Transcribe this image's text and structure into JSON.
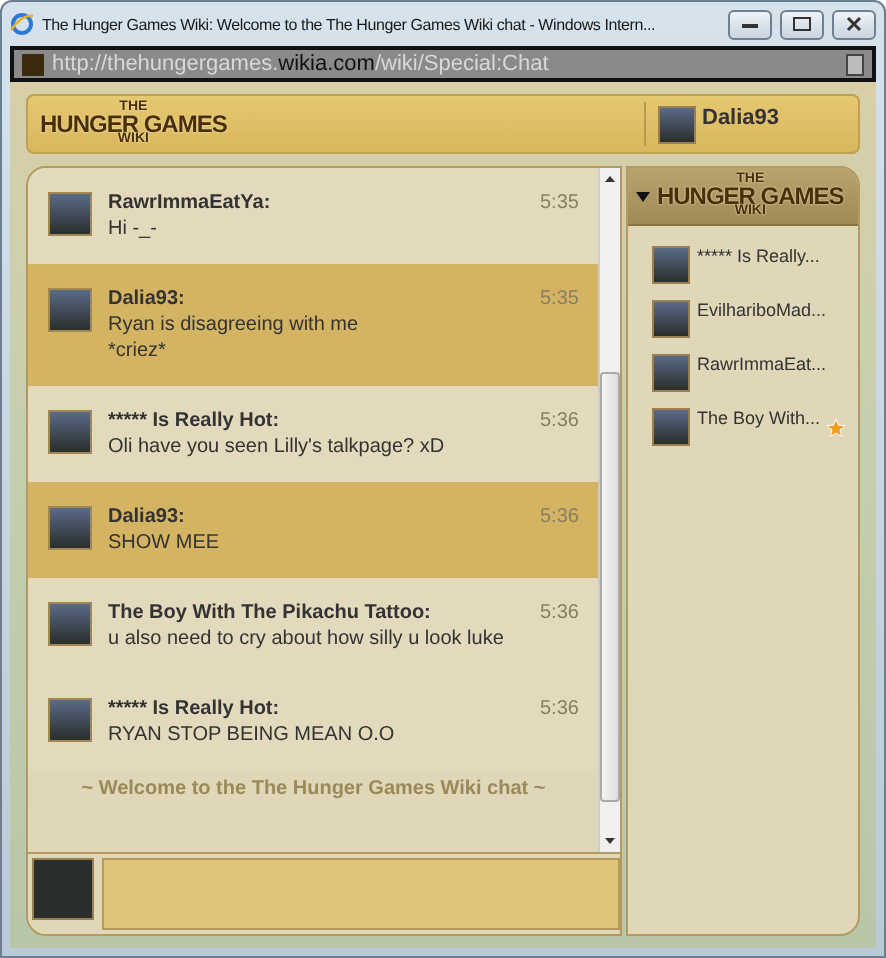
{
  "window": {
    "title": "The Hunger Games Wiki: Welcome to the The Hunger Games Wiki chat - Windows Intern..."
  },
  "address_bar": {
    "url_start": "http://thehungergames.",
    "url_domain": "wikia.com",
    "url_end": "/wiki/Special:Chat"
  },
  "header": {
    "logo": [
      "THE",
      "HUNGER GAMES",
      "WIKI"
    ],
    "user": "Dalia93"
  },
  "messages": [
    {
      "user": "RawrImmaEatYa:",
      "text": [
        "Hi -_-"
      ],
      "time": "5:35",
      "highlighted": false
    },
    {
      "user": "Dalia93:",
      "text": [
        "Ryan is disagreeing with me",
        "*criez*"
      ],
      "time": "5:35",
      "highlighted": true
    },
    {
      "user": "***** Is Really Hot:",
      "text": [
        "Oli have you seen Lilly's talkpage? xD"
      ],
      "time": "5:36",
      "highlighted": false
    },
    {
      "user": "Dalia93:",
      "text": [
        "SHOW MEE"
      ],
      "time": "5:36",
      "highlighted": true
    },
    {
      "user": "The Boy With The Pikachu Tattoo:",
      "text": [
        "u also need to cry about how silly u look luke"
      ],
      "time": "5:36",
      "highlighted": false
    },
    {
      "user": "***** Is Really Hot:",
      "text": [
        "RYAN STOP BEING MEAN O.O"
      ],
      "time": "5:36",
      "highlighted": false
    }
  ],
  "welcome": "~ Welcome to the The Hunger Games Wiki chat ~",
  "sidebar": {
    "logo": [
      "THE",
      "HUNGER GAMES",
      "WIKI"
    ],
    "expanded": true,
    "users": [
      {
        "name": "***** Is Really...",
        "moderator": false
      },
      {
        "name": "EvilhariboMad...",
        "moderator": false
      },
      {
        "name": "RawrImmaEat...",
        "moderator": false
      },
      {
        "name": "The Boy With...",
        "moderator": true
      }
    ]
  }
}
